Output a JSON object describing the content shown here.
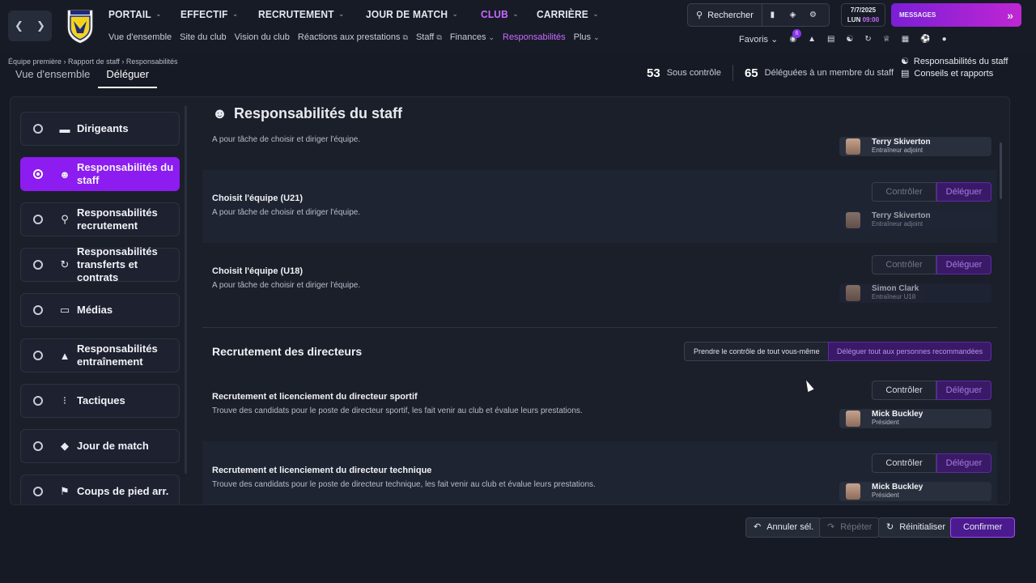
{
  "topnav": {
    "items": [
      {
        "label": "PORTAIL",
        "active": false
      },
      {
        "label": "EFFECTIF",
        "active": false
      },
      {
        "label": "RECRUTEMENT",
        "active": false
      },
      {
        "label": "JOUR DE MATCH",
        "active": false
      },
      {
        "label": "CLUB",
        "active": true
      },
      {
        "label": "CARRIÈRE",
        "active": false
      }
    ],
    "subnav": [
      {
        "label": "Vue d'ensemble"
      },
      {
        "label": "Site du club"
      },
      {
        "label": "Vision du club"
      },
      {
        "label": "Réactions aux prestations",
        "external": true
      },
      {
        "label": "Staff",
        "external": true
      },
      {
        "label": "Finances",
        "dropdown": true
      },
      {
        "label": "Responsabilités",
        "active": true
      },
      {
        "label": "Plus",
        "dropdown": true
      }
    ],
    "search_label": "Rechercher",
    "date": "7/7/2025",
    "day": "LUN",
    "time": "09:00",
    "messages_label": "MESSAGES",
    "favorites_label": "Favoris",
    "notif_count": "6"
  },
  "header": {
    "breadcrumb": [
      "Équipe première",
      "Rapport de staff",
      "Responsabilités"
    ],
    "tabs": [
      {
        "label": "Vue d'ensemble",
        "active": false
      },
      {
        "label": "Déléguer",
        "active": true
      }
    ],
    "controlled_count": "53",
    "controlled_label": "Sous contrôle",
    "delegated_count": "65",
    "delegated_label": "Déléguées à un membre du staff",
    "link_staff": "Responsabilités du staff",
    "link_reports": "Conseils et rapports"
  },
  "sidebar": {
    "items": [
      {
        "label": "Dirigeants",
        "icon": "hat-icon",
        "active": false
      },
      {
        "label": "Responsabilités du staff",
        "icon": "person-icon",
        "active": true
      },
      {
        "label": "Responsabilités recrutement",
        "icon": "search-icon",
        "active": false
      },
      {
        "label": "Responsabilités transferts et contrats",
        "icon": "transfer-icon",
        "active": false
      },
      {
        "label": "Médias",
        "icon": "tv-icon",
        "active": false
      },
      {
        "label": "Responsabilités entraînement",
        "icon": "cone-icon",
        "active": false
      },
      {
        "label": "Tactiques",
        "icon": "tactics-icon",
        "active": false
      },
      {
        "label": "Jour de match",
        "icon": "pitch-icon",
        "active": false
      },
      {
        "label": "Coups de pied arr.",
        "icon": "flag-icon",
        "active": false
      }
    ]
  },
  "content": {
    "title": "Responsabilités du staff",
    "first_row_desc": "A pour tâche de choisir et diriger l'équipe.",
    "first_row_person": {
      "name": "Terry Skiverton",
      "role": "Entraîneur adjoint"
    },
    "rows": [
      {
        "title": "Choisit l'équipe (U21)",
        "desc": "A pour tâche de choisir et diriger l'équipe.",
        "person": "Terry Skiverton",
        "role": "Entraîneur adjoint"
      },
      {
        "title": "Choisit l'équipe (U18)",
        "desc": "A pour tâche de choisir et diriger l'équipe.",
        "person": "Simon Clark",
        "role": "Entraîneur U18"
      }
    ],
    "control_label": "Contrôler",
    "delegate_label": "Déléguer",
    "section2": {
      "title": "Recrutement des directeurs",
      "take_all_label": "Prendre le contrôle de tout vous-même",
      "delegate_all_label": "Déléguer tout aux personnes recommandées",
      "rows": [
        {
          "title": "Recrutement et licenciement du directeur sportif",
          "desc": "Trouve des candidats pour le poste de directeur sportif, les fait venir au club et évalue leurs prestations.",
          "person": "Mick Buckley",
          "role": "Président"
        },
        {
          "title": "Recrutement et licenciement du directeur technique",
          "desc": "Trouve des candidats pour le poste de directeur technique, les fait venir au club et évalue leurs prestations.",
          "person": "Mick Buckley",
          "role": "Président"
        }
      ]
    }
  },
  "footer": {
    "undo": "Annuler sél.",
    "redo": "Répéter",
    "reset": "Réinitialiser",
    "confirm": "Confirmer"
  },
  "colors": {
    "accent": "#8c1cf0",
    "active_text": "#c86bff",
    "background": "#161a24"
  }
}
